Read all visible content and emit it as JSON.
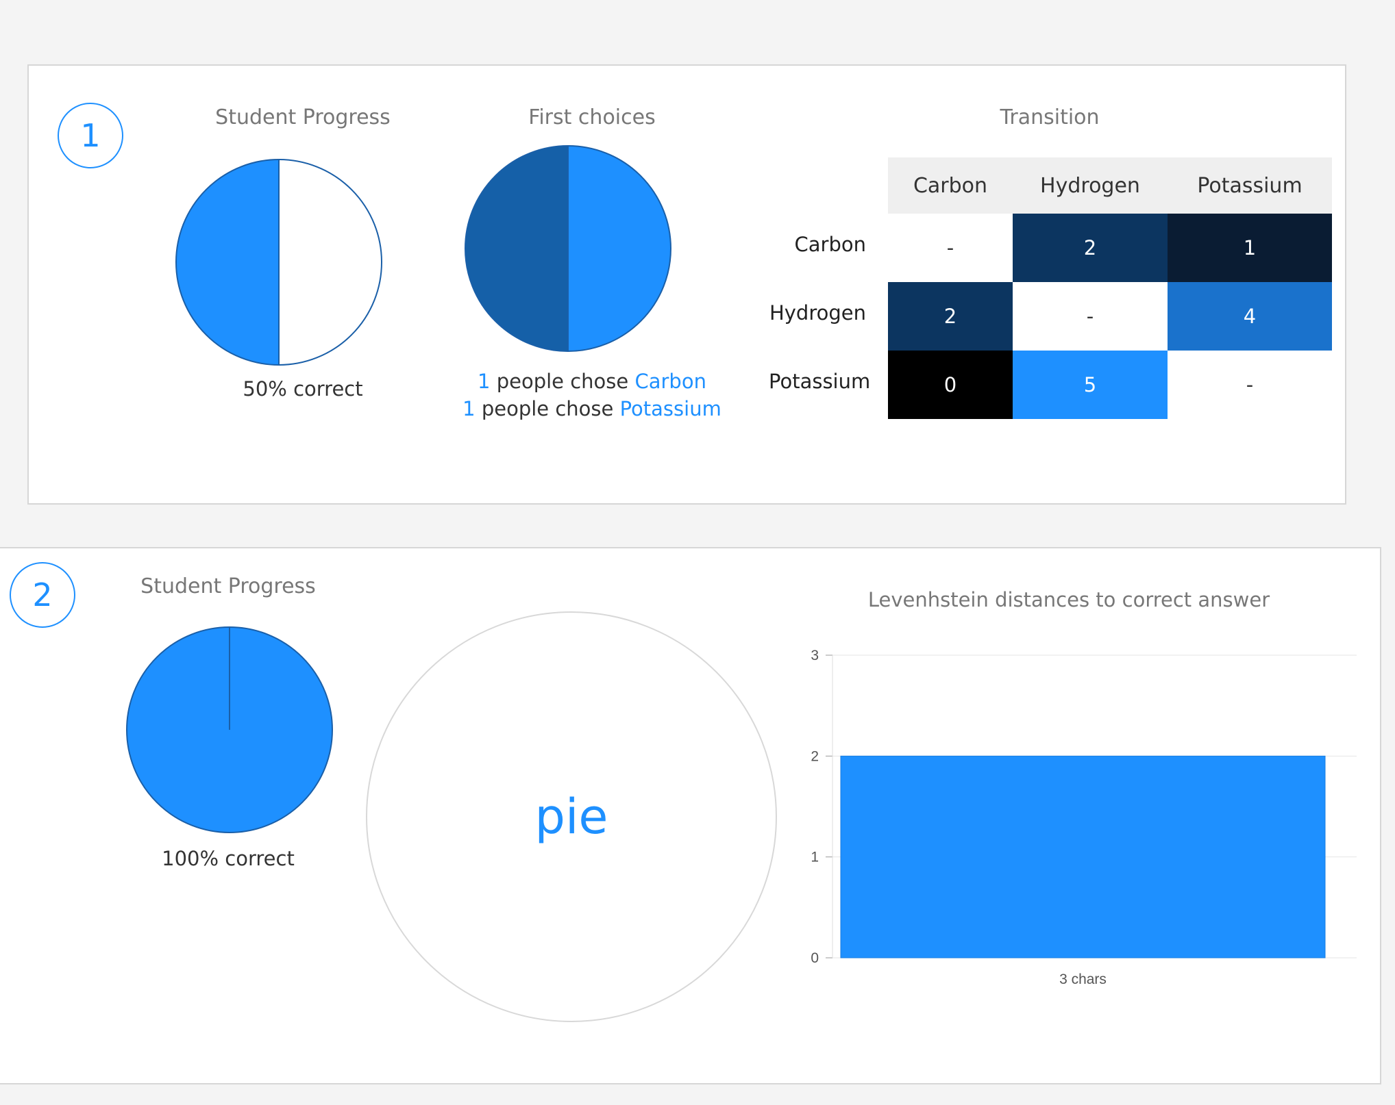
{
  "questions": [
    {
      "number": "1",
      "progress": {
        "title": "Student Progress",
        "percent": 50,
        "caption": "50% correct"
      },
      "first_choices": {
        "title": "First choices",
        "lines": [
          {
            "count": "1",
            "text": "people chose",
            "choice": "Carbon"
          },
          {
            "count": "1",
            "text": "people chose",
            "choice": "Potassium"
          }
        ]
      },
      "transition": {
        "title": "Transition",
        "columns": [
          "Carbon",
          "Hydrogen",
          "Potassium"
        ],
        "rows": [
          {
            "label": "Carbon",
            "cells": [
              "-",
              "2",
              "1"
            ]
          },
          {
            "label": "Hydrogen",
            "cells": [
              "2",
              "-",
              "4"
            ]
          },
          {
            "label": "Potassium",
            "cells": [
              "0",
              "5",
              "-"
            ]
          }
        ],
        "cell_colors": [
          [
            "#ffffff",
            "#0c3560",
            "#0a1c33"
          ],
          [
            "#0c3560",
            "#ffffff",
            "#1a72cc"
          ],
          [
            "#000000",
            "#1e90ff",
            "#ffffff"
          ]
        ]
      }
    },
    {
      "number": "2",
      "progress": {
        "title": "Student Progress",
        "percent": 100,
        "caption": "100% correct"
      },
      "pie_label": "pie",
      "distances": {
        "title": "Levenhstein distances to correct answer"
      }
    }
  ],
  "chart_data": [
    {
      "type": "pie",
      "title": "Student Progress",
      "slices": [
        {
          "label": "correct",
          "value": 50
        },
        {
          "label": "incorrect",
          "value": 50
        }
      ]
    },
    {
      "type": "pie",
      "title": "First choices",
      "slices": [
        {
          "label": "Carbon",
          "value": 1
        },
        {
          "label": "Potassium",
          "value": 1
        }
      ]
    },
    {
      "type": "heatmap",
      "title": "Transition",
      "x": [
        "Carbon",
        "Hydrogen",
        "Potassium"
      ],
      "y": [
        "Carbon",
        "Hydrogen",
        "Potassium"
      ],
      "values": [
        [
          null,
          2,
          1
        ],
        [
          2,
          null,
          4
        ],
        [
          0,
          5,
          null
        ]
      ]
    },
    {
      "type": "pie",
      "title": "Student Progress",
      "slices": [
        {
          "label": "correct",
          "value": 100
        }
      ]
    },
    {
      "type": "bar",
      "title": "Levenhstein distances to correct answer",
      "categories": [
        "3 chars"
      ],
      "values": [
        2
      ],
      "ylim": [
        0,
        3
      ],
      "yticks": [
        "0",
        "1",
        "2",
        "3"
      ],
      "grid": true
    }
  ],
  "colors": {
    "accent": "#1e90ff",
    "dark_blue": "#1560a8",
    "outline": "#1a5fa8"
  }
}
